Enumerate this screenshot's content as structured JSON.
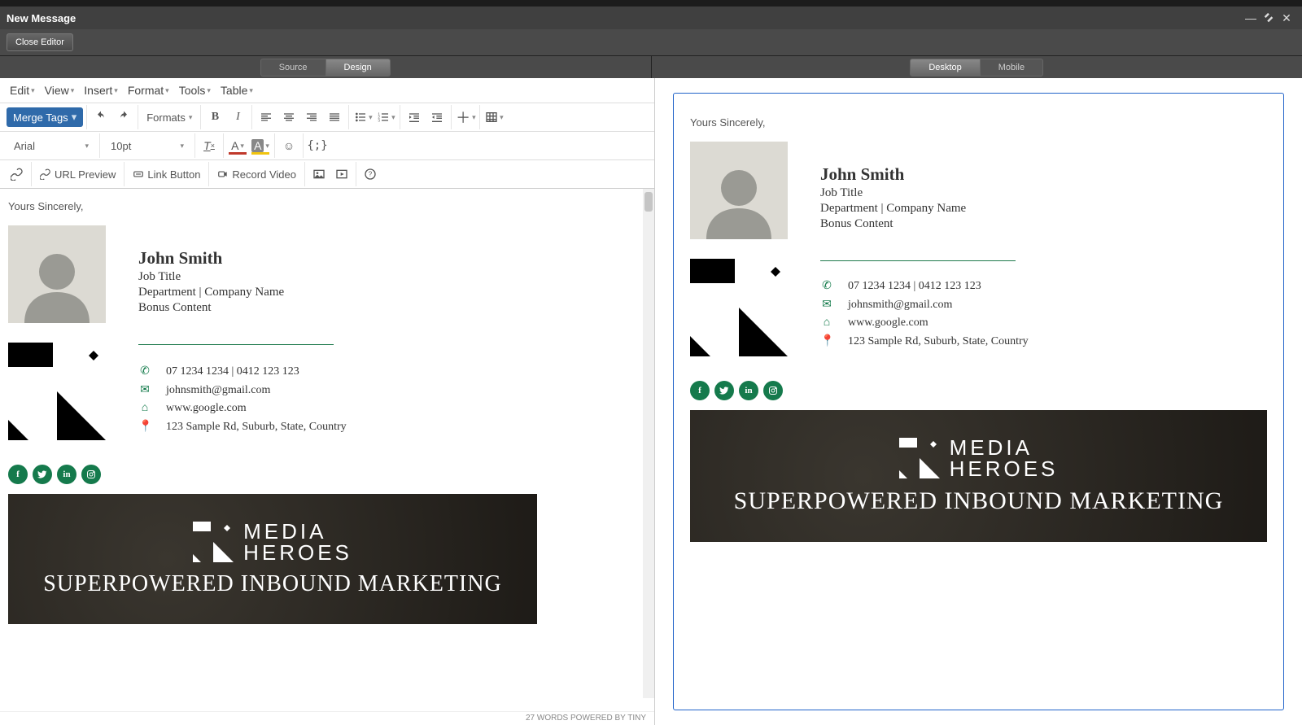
{
  "window": {
    "title": "New Message"
  },
  "buttons": {
    "close_editor": "Close Editor"
  },
  "editor_tabs": {
    "source": "Source",
    "design": "Design"
  },
  "preview_tabs": {
    "desktop": "Desktop",
    "mobile": "Mobile"
  },
  "menubar": {
    "edit": "Edit",
    "view": "View",
    "insert": "Insert",
    "format": "Format",
    "tools": "Tools",
    "table": "Table"
  },
  "toolbar": {
    "merge_tags": "Merge Tags",
    "formats": "Formats",
    "font_family": "Arial",
    "font_size": "10pt",
    "url_preview": "URL Preview",
    "link_button": "Link Button",
    "record_video": "Record Video"
  },
  "status_bar": "27 WORDS POWERED BY TINY",
  "signature": {
    "greeting": "Yours Sincerely,",
    "name": "John Smith",
    "job_title": "Job Title",
    "dept_company": "Department | Company Name",
    "bonus": "Bonus Content",
    "phone": "07 1234 1234  |   0412 123 123",
    "email": "johnsmith@gmail.com",
    "website": "www.google.com",
    "address": "123 Sample Rd, Suburb, State, Country",
    "banner_brand_top": "MEDIA",
    "banner_brand_bottom": "HEROES",
    "banner_tagline": "SUPERPOWERED INBOUND MARKETING"
  },
  "colors": {
    "accent": "#157a4c",
    "brand_blue": "#2f6aaa"
  }
}
